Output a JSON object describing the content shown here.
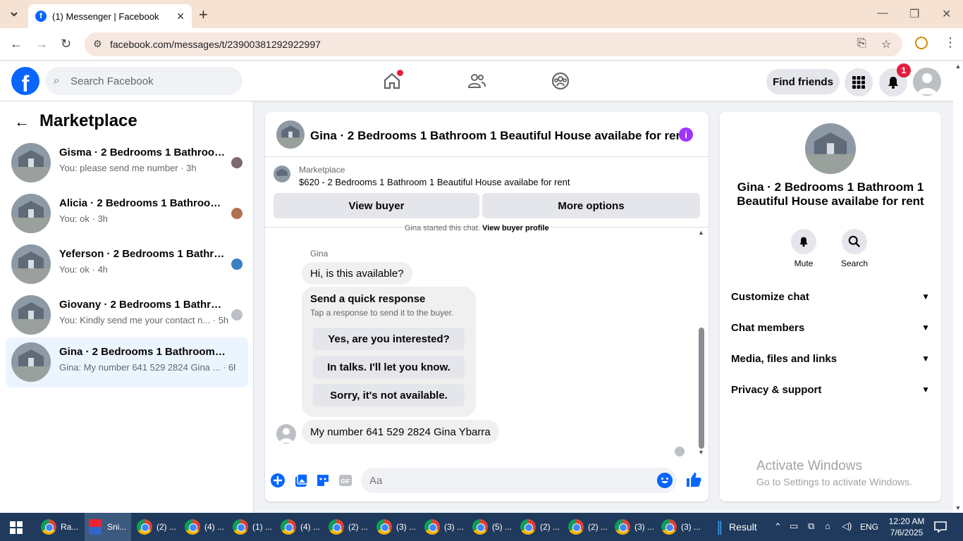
{
  "browser": {
    "tab_title": "(1) Messenger | Facebook",
    "url": "facebook.com/messages/t/23900381292922997"
  },
  "fb": {
    "search_placeholder": "Search Facebook",
    "find_friends": "Find friends",
    "notif_count": "1"
  },
  "sidebar": {
    "title": "Marketplace",
    "conversations": [
      {
        "name": "Gisma · 2 Bedrooms 1 Bathroom...",
        "preview": "You: please send me number · 3h",
        "avatar_color": "#7a6a70"
      },
      {
        "name": "Alicia · 2 Bedrooms 1 Bathroom ...",
        "preview": "You: ok · 3h",
        "avatar_color": "#b07050"
      },
      {
        "name": "Yeferson · 2 Bedrooms 1 Bathro...",
        "preview": "You: ok · 4h",
        "avatar_color": "#3a7fc1"
      },
      {
        "name": "Giovany · 2 Bedrooms 1 Bathroo...",
        "preview": "You: Kindly send me your contact n... · 5h",
        "avatar_color": "#bcc0c4"
      },
      {
        "name": "Gina · 2 Bedrooms 1 Bathroom 1 B...",
        "preview": "Gina: My number 641 529 2824 Gina ... · 6h",
        "avatar_color": ""
      }
    ]
  },
  "chat": {
    "title": "Gina · 2 Bedrooms 1 Bathroom 1 Beautiful House availabe for rent",
    "listing_source": "Marketplace",
    "listing_desc": "$620 - 2 Bedrooms 1 Bathroom 1 Beautiful House availabe for rent",
    "view_buyer": "View buyer",
    "more_options": "More options",
    "started_text": "Gina started this chat.",
    "view_buyer_profile": "View buyer profile",
    "sender": "Gina",
    "msg1": "Hi, is this available?",
    "quick_title": "Send a quick response",
    "quick_sub": "Tap a response to send it to the buyer.",
    "quick_replies": [
      "Yes, are you interested?",
      "In talks. I'll let you know.",
      "Sorry, it's not available."
    ],
    "msg2": "My number 641 529 2824 Gina Ybarra",
    "input_placeholder": "Aa"
  },
  "right_panel": {
    "title": "Gina · 2 Bedrooms 1 Bathroom 1 Beautiful House availabe for rent",
    "mute": "Mute",
    "search": "Search",
    "rows": [
      "Customize chat",
      "Chat members",
      "Media, files and links",
      "Privacy & support"
    ],
    "activate_1": "Activate Windows",
    "activate_2": "Go to Settings to activate Windows."
  },
  "taskbar": {
    "items": [
      "Ra...",
      "Sni...",
      "(2) ...",
      "(4) ...",
      "(1) ...",
      "(4) ...",
      "(2) ...",
      "(3) ...",
      "(3) ...",
      "(5) ...",
      "(2) ...",
      "(2) ...",
      "(3) ...",
      "(3) ..."
    ],
    "weather": "Result",
    "lang": "ENG",
    "time": "12:20 AM",
    "date": "7/6/2025"
  },
  "colors": {
    "accent": "#0866ff",
    "badge": "#e41e3f",
    "info": "#a033ff"
  }
}
